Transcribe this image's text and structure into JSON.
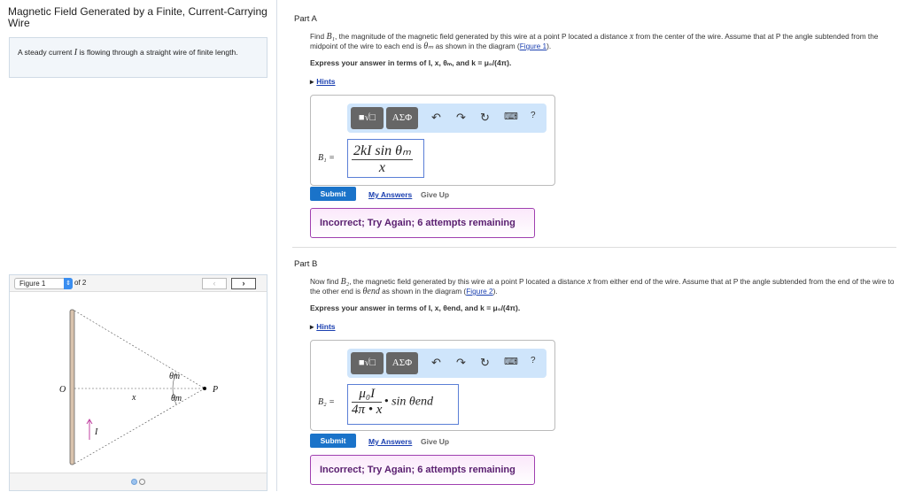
{
  "left": {
    "title": "Magnetic Field Generated by a Finite, Current-Carrying Wire",
    "intro_pre": "A steady current ",
    "intro_var": "I",
    "intro_post": " is flowing through a straight wire of finite length.",
    "figure": {
      "select": "Figure 1",
      "of": "of 2",
      "prev": "‹",
      "next": "›",
      "labels": {
        "O": "O",
        "x": "x",
        "theta_top": "θm",
        "theta_bot": "θm",
        "P": "P",
        "I": "I"
      }
    }
  },
  "partA": {
    "label": "Part A",
    "q1": "Find ",
    "var_B": "B₁",
    "q2": ", the magnitude of the magnetic field generated by this wire at a point P located a distance ",
    "var_x": "x",
    "q3": " from the center of the wire. Assume that at P the angle subtended from the midpoint of the wire to each end is ",
    "var_theta": "θₘ",
    "q4": " as shown in the diagram (",
    "fig_link": "Figure 1",
    "q5": ").",
    "express": "Express your answer in terms of I, x, θₘ, and k = μ₀/(4π).",
    "hints": "Hints",
    "lhs": "B₁ =",
    "ans_num": "2kI sin θₘ",
    "ans_den": "x",
    "submit": "Submit",
    "my_answers": "My Answers",
    "give_up": "Give Up",
    "feedback": "Incorrect; Try Again; 6 attempts remaining"
  },
  "partB": {
    "label": "Part B",
    "q1": "Now find ",
    "var_B": "B₂",
    "q2": ", the magnetic field generated by this wire at a point P located a distance ",
    "var_x": "x",
    "q3": " from either end of the wire. Assume that at P the angle subtended from the end of the wire to the other end is ",
    "var_theta": "θend",
    "q4": " as shown in the diagram (",
    "fig_link": "Figure 2",
    "q5": ").",
    "express": "Express your answer in terms of I, x, θend, and k = μ₀/(4π).",
    "hints": "Hints",
    "lhs": "B₂ =",
    "ans_num": "μ₀I",
    "ans_den": "4π • x",
    "ans_tail": "• sin θend",
    "submit": "Submit",
    "my_answers": "My Answers",
    "give_up": "Give Up",
    "feedback": "Incorrect; Try Again; 6 attempts remaining"
  },
  "toolbar": {
    "templates": "■√□",
    "greek": "ΑΣΦ",
    "undo": "↶",
    "redo": "↷",
    "reset": "↻",
    "keyboard": "⌨",
    "help": "?"
  }
}
